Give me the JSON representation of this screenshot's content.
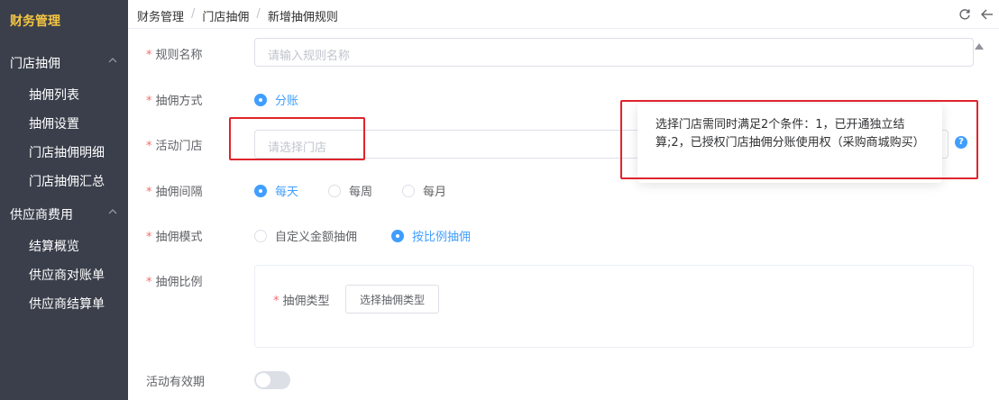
{
  "sidebar": {
    "brand": "财务管理",
    "groups": [
      {
        "label": "门店抽佣",
        "items": [
          "抽佣列表",
          "抽佣设置",
          "门店抽佣明细",
          "门店抽佣汇总"
        ]
      },
      {
        "label": "供应商费用",
        "items": [
          "结算概览",
          "供应商对账单",
          "供应商结算单"
        ]
      }
    ]
  },
  "header": {
    "breadcrumb": [
      "财务管理",
      "门店抽佣",
      "新增抽佣规则"
    ],
    "sep": "/",
    "icons": [
      "refresh-icon",
      "back-arrow-icon"
    ]
  },
  "form": {
    "rule_name": {
      "label": "规则名称",
      "placeholder": "请输入规则名称"
    },
    "method": {
      "label": "抽佣方式",
      "options": [
        "分账"
      ],
      "selected": "分账"
    },
    "store": {
      "label": "活动门店",
      "placeholder": "请选择门店"
    },
    "interval": {
      "label": "抽佣间隔",
      "options": [
        "每天",
        "每周",
        "每月"
      ],
      "selected": "每天"
    },
    "mode": {
      "label": "抽佣模式",
      "options": [
        "自定义金额抽佣",
        "按比例抽佣"
      ],
      "selected": "按比例抽佣"
    },
    "ratio": {
      "label": "抽佣比例",
      "type_label": "抽佣类型",
      "type_button": "选择抽佣类型"
    },
    "validity": {
      "label": "活动有效期",
      "enabled": false
    }
  },
  "tooltip": {
    "text": "选择门店需同时满足2个条件：1，已开通独立结算;2，已授权门店抽佣分账使用权（采购商城购买）",
    "help_glyph": "?"
  },
  "colors": {
    "accent": "#409eff",
    "required": "#f56c6c",
    "annotation": "#e0242b",
    "brand": "#f5c542",
    "sidebar": "#3a3f4b"
  }
}
